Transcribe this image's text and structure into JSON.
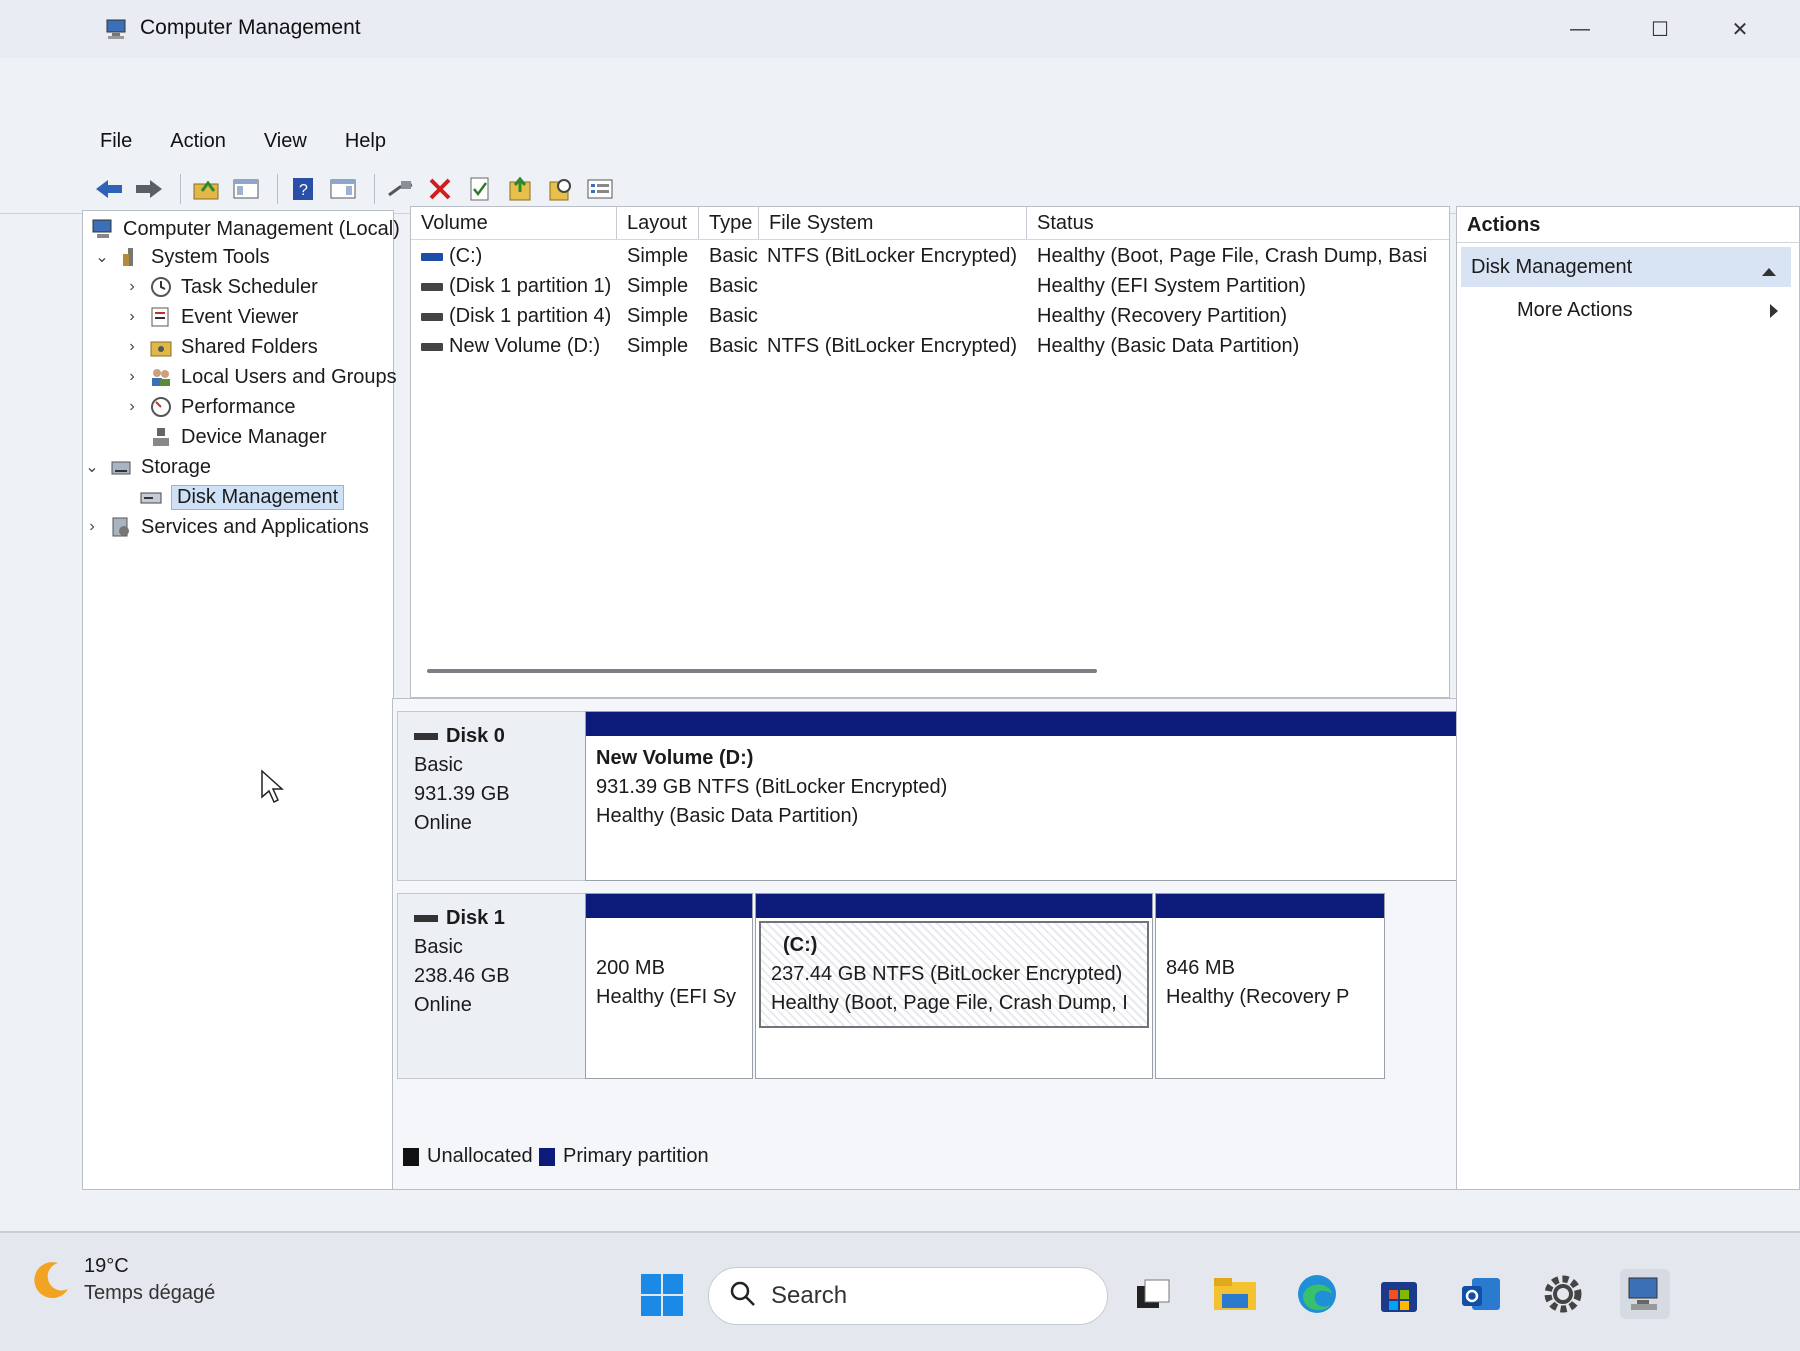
{
  "window": {
    "title": "Computer Management",
    "controls": {
      "minimize": "—",
      "maximize": "☐",
      "close": "✕"
    }
  },
  "menu": [
    "File",
    "Action",
    "View",
    "Help"
  ],
  "tree": {
    "items": [
      {
        "label": "Computer Management (Local)",
        "icon": "computer-management-icon"
      },
      {
        "label": "System Tools",
        "icon": "system-tools-icon",
        "chevron": "⌄"
      },
      {
        "label": "Task Scheduler",
        "icon": "task-scheduler-icon",
        "chevron": "›"
      },
      {
        "label": "Event Viewer",
        "icon": "event-viewer-icon",
        "chevron": "›"
      },
      {
        "label": "Shared Folders",
        "icon": "shared-folders-icon",
        "chevron": "›"
      },
      {
        "label": "Local Users and Groups",
        "icon": "users-icon",
        "chevron": "›"
      },
      {
        "label": "Performance",
        "icon": "performance-icon",
        "chevron": "›"
      },
      {
        "label": "Device Manager",
        "icon": "device-manager-icon"
      },
      {
        "label": "Storage",
        "icon": "storage-icon",
        "chevron": "⌄"
      },
      {
        "label": "Disk Management",
        "icon": "disk-management-icon",
        "selected": true
      },
      {
        "label": "Services and Applications",
        "icon": "services-icon",
        "chevron": "›"
      }
    ]
  },
  "volumes": {
    "columns": [
      "Volume",
      "Layout",
      "Type",
      "File System",
      "Status"
    ],
    "rows": [
      {
        "volume": "(C:)",
        "layout": "Simple",
        "type": "Basic",
        "fs": "NTFS (BitLocker Encrypted)",
        "status": "Healthy (Boot, Page File, Crash Dump, Basi"
      },
      {
        "volume": "(Disk 1 partition 1)",
        "layout": "Simple",
        "type": "Basic",
        "fs": "",
        "status": "Healthy (EFI System Partition)"
      },
      {
        "volume": "(Disk 1 partition 4)",
        "layout": "Simple",
        "type": "Basic",
        "fs": "",
        "status": "Healthy (Recovery Partition)"
      },
      {
        "volume": "New Volume (D:)",
        "layout": "Simple",
        "type": "Basic",
        "fs": "NTFS (BitLocker Encrypted)",
        "status": "Healthy (Basic Data Partition)"
      }
    ]
  },
  "disks": [
    {
      "name": "Disk 0",
      "kind": "Basic",
      "size": "931.39 GB",
      "state": "Online",
      "partitions": [
        {
          "title": "New Volume  (D:)",
          "line1": "931.39 GB NTFS (BitLocker Encrypted)",
          "line2": "Healthy (Basic Data Partition)"
        }
      ]
    },
    {
      "name": "Disk 1",
      "kind": "Basic",
      "size": "238.46 GB",
      "state": "Online",
      "partitions": [
        {
          "title": "",
          "line1": "200 MB",
          "line2": "Healthy (EFI Sy"
        },
        {
          "title": "(C:)",
          "line1": "237.44 GB NTFS (BitLocker Encrypted)",
          "line2": "Healthy (Boot, Page File, Crash Dump, I"
        },
        {
          "title": "",
          "line1": "846 MB",
          "line2": "Healthy (Recovery P"
        }
      ]
    }
  ],
  "legend": [
    {
      "label": "Unallocated",
      "color": "#111111"
    },
    {
      "label": "Primary partition",
      "color": "#0c1a7a"
    }
  ],
  "actions": {
    "title": "Actions",
    "section": "Disk Management",
    "more": "More Actions"
  },
  "taskbar": {
    "weather_temp": "19°C",
    "weather_desc": "Temps dégagé",
    "search": "Search"
  }
}
